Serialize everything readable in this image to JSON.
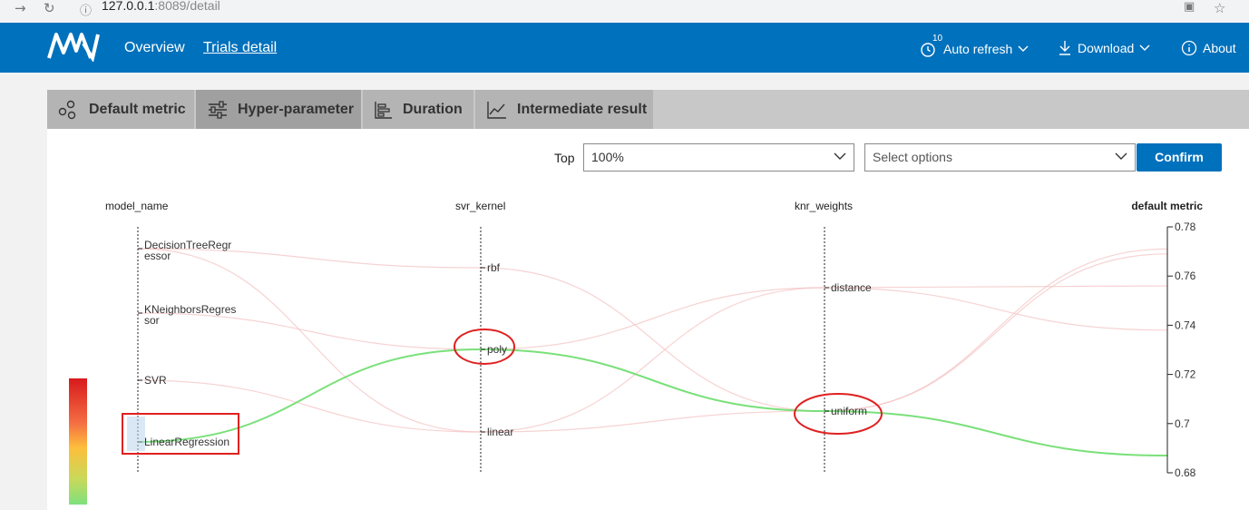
{
  "browser": {
    "url_host": "127.0.0.1",
    "url_rest": ":8089/detail"
  },
  "header": {
    "nav": [
      "Overview",
      "Trials detail"
    ],
    "refresh_badge": "10",
    "auto_refresh": "Auto refresh",
    "download": "Download",
    "about": "About"
  },
  "tabs": [
    {
      "label": "Default metric",
      "icon": "scatter-icon"
    },
    {
      "label": "Hyper-parameter",
      "icon": "sliders-icon"
    },
    {
      "label": "Duration",
      "icon": "bar-chart-icon"
    },
    {
      "label": "Intermediate result",
      "icon": "line-chart-icon"
    }
  ],
  "controls": {
    "top_label": "Top",
    "top_value": "100%",
    "options_placeholder": "Select options",
    "confirm": "Confirm"
  },
  "chart_data": {
    "type": "parallel-coordinates",
    "axes": [
      {
        "name": "model_name",
        "categories": [
          "DecisionTreeRegressor",
          "KNeighborsRegressor",
          "SVR",
          "LinearRegression"
        ]
      },
      {
        "name": "svr_kernel",
        "categories": [
          "rbf",
          "poly",
          "linear"
        ]
      },
      {
        "name": "knr_weights",
        "categories": [
          "distance",
          "uniform"
        ]
      },
      {
        "name": "default metric",
        "ticks": [
          0.78,
          0.76,
          0.74,
          0.72,
          0.7,
          0.68
        ],
        "tick_labels": [
          "0.78",
          "0.76",
          "0.74",
          "0.72",
          "0.7",
          "0.68"
        ],
        "range": [
          0.68,
          0.78
        ]
      }
    ],
    "color_scale": [
      "#d7191c",
      "#fdae61",
      "#a6d96a",
      "#66d966"
    ],
    "lines": [
      {
        "model_name": "LinearRegression",
        "svr_kernel": "poly",
        "knr_weights": "uniform",
        "metric": 0.687,
        "highlight": true
      },
      {
        "model_name": "DecisionTreeRegressor",
        "svr_kernel": "rbf",
        "knr_weights": "uniform",
        "metric": 0.771,
        "highlight": false
      },
      {
        "model_name": "DecisionTreeRegressor",
        "svr_kernel": "linear",
        "knr_weights": "distance",
        "metric": 0.756,
        "highlight": false
      },
      {
        "model_name": "KNeighborsRegressor",
        "svr_kernel": "poly",
        "knr_weights": "distance",
        "metric": 0.738,
        "highlight": false
      },
      {
        "model_name": "SVR",
        "svr_kernel": "linear",
        "knr_weights": "uniform",
        "metric": 0.769,
        "highlight": false
      }
    ]
  }
}
